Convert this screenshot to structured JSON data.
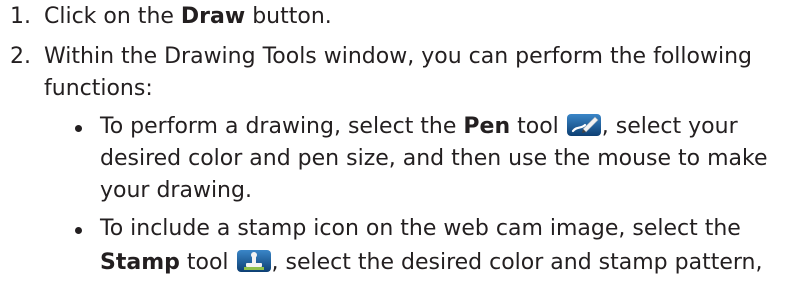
{
  "steps": [
    {
      "number": "1.",
      "pre": "Click on the ",
      "bold": "Draw",
      "post": " button."
    },
    {
      "number": "2.",
      "line1": "Within the Drawing Tools window, you can perform the following",
      "line2": "functions:"
    }
  ],
  "bullets": [
    {
      "l1_pre": "To perform a drawing, select the ",
      "l1_bold": "Pen",
      "l1_mid": " tool ",
      "l1_post": ", select your",
      "l2": "desired color and pen size, and then use the mouse to make",
      "l3": "your drawing.",
      "icon": "pen-tool-icon"
    },
    {
      "l1": "To include a stamp icon on the web cam image, select the",
      "l2_bold": "Stamp",
      "l2_mid": " tool ",
      "l2_post": ", select the desired color and stamp pattern,",
      "icon": "stamp-tool-icon"
    }
  ],
  "colors": {
    "text": "#231f20",
    "icon_blue": "#1f5fa0",
    "stamp_accent": "#8fc049"
  }
}
